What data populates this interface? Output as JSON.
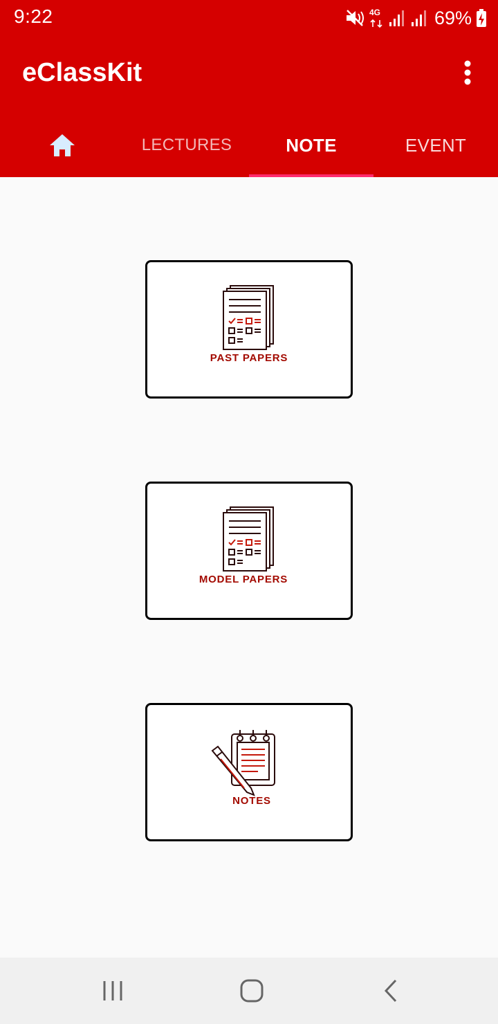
{
  "status_bar": {
    "time": "9:22",
    "network_label": "4G",
    "battery_percent": "69%"
  },
  "app": {
    "title": "eClassKit"
  },
  "tabs": [
    {
      "label": "",
      "icon": "home-icon"
    },
    {
      "label": "LECTURES"
    },
    {
      "label": "NOTE",
      "selected": true
    },
    {
      "label": "EVENT"
    }
  ],
  "cards": [
    {
      "label": "PAST PAPERS",
      "icon": "exam-papers-icon"
    },
    {
      "label": "MODEL PAPERS",
      "icon": "exam-papers-icon"
    },
    {
      "label": "NOTES",
      "icon": "notepad-pen-icon"
    }
  ],
  "colors": {
    "primary": "#d50000",
    "tab_indicator": "#ff2a6d",
    "card_accent": "#a30a00",
    "background": "#fafafa",
    "home_icon": "#d8ecff"
  }
}
